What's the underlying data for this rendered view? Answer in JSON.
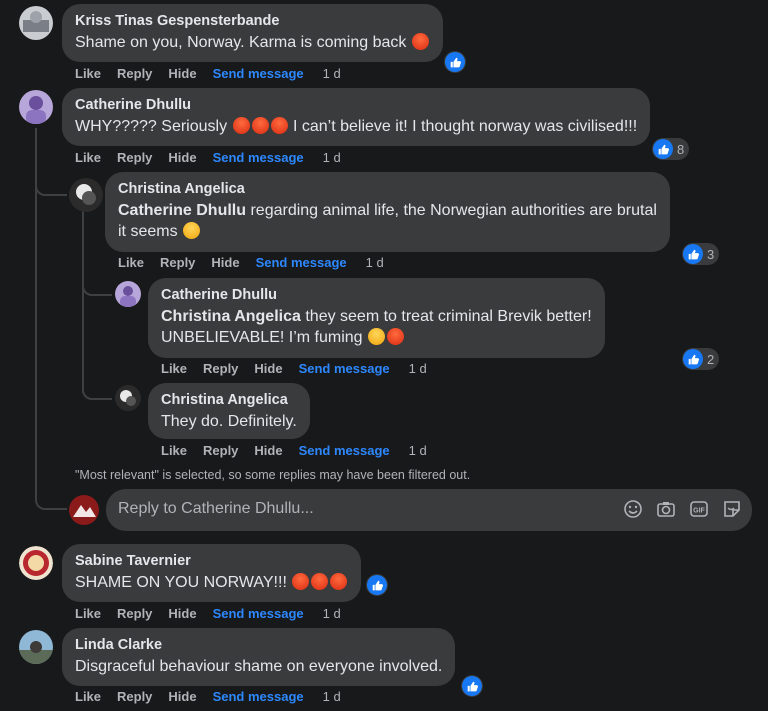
{
  "actions": {
    "like": "Like",
    "reply": "Reply",
    "hide": "Hide",
    "send_message": "Send message",
    "time": "1 d"
  },
  "comments": [
    {
      "author": "Kriss Tinas Gespensterbande",
      "text": "Shame on you, Norway. Karma is coming back",
      "emojis": [
        "angry"
      ],
      "like_count": ""
    },
    {
      "author": "Catherine Dhullu",
      "text": "WHY????? Seriously",
      "text_after": "I can’t believe it! I thought norway was civilised!!!",
      "emojis": [
        "angry",
        "angry",
        "angry"
      ],
      "like_count": "8",
      "replies": [
        {
          "author": "Christina Angelica",
          "mention": "Catherine Dhullu",
          "text": "regarding animal life, the Norwegian authorities are brutal",
          "text_line2": "it seems",
          "emojis": [
            "crying"
          ],
          "like_count": "3"
        },
        {
          "author": "Catherine Dhullu",
          "mention": "Christina Angelica",
          "text": "they seem to treat criminal Brevik better!",
          "text_line2": "UNBELIEVABLE! I’m fuming",
          "emojis": [
            "steam",
            "angry"
          ],
          "like_count": "2"
        },
        {
          "author": "Christina Angelica",
          "text": "They do. Definitely.",
          "like_count": ""
        }
      ],
      "filter_notice": "\"Most relevant\" is selected, so some replies may have been filtered out.",
      "reply_placeholder": "Reply to Catherine Dhullu..."
    },
    {
      "author": "Sabine Tavernier",
      "text": "SHAME ON YOU NORWAY!!!",
      "emojis": [
        "angry",
        "angry",
        "angry"
      ],
      "like_count": ""
    },
    {
      "author": "Linda Clarke",
      "text": "Disgraceful behaviour shame on everyone involved.",
      "like_count": ""
    }
  ],
  "reply_icons": [
    "emoji-icon",
    "camera-icon",
    "gif-icon",
    "sticker-icon"
  ],
  "colors": {
    "background": "#18191a",
    "bubble": "#3a3b3c",
    "link": "#2d88ff",
    "like_blue": "#1877f2",
    "muted": "#b0b3b8"
  }
}
